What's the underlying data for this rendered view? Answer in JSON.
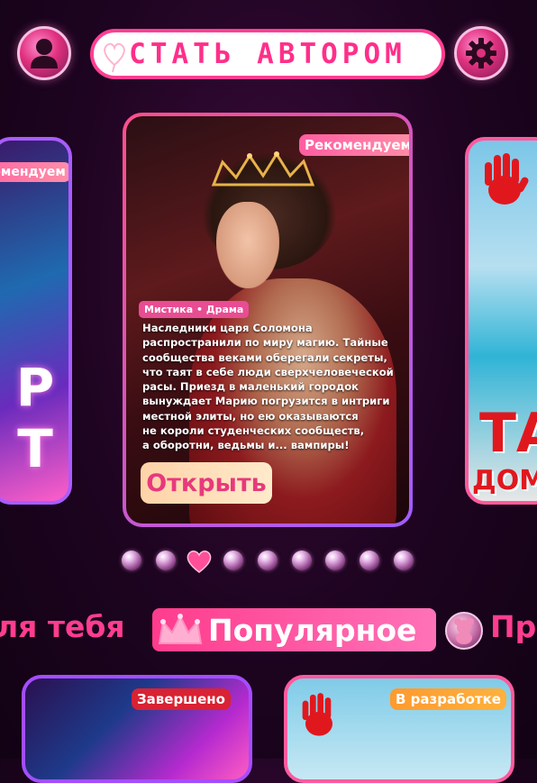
{
  "header": {
    "become_author_label": "СТАТЬ АВТОРОМ",
    "profile_icon": "user-icon",
    "settings_icon": "gear-icon"
  },
  "featured": {
    "left_card": {
      "badge": "Рекомендуем",
      "cover_text": "P T"
    },
    "main_card": {
      "badge": "Рекомендуем",
      "genres": "Мистика • Драма",
      "description_lines": [
        "Наследники царя Соломона",
        "распространили по миру магию. Тайные",
        "сообщества веками оберегали секреты,",
        "что таят в себе люди сверхчеловеческой",
        "расы. Приезд в маленький городок",
        "вынуждает Марию погрузится в интриги",
        "местной элиты, но ею оказываются",
        "не короли студенческих сообществ,",
        "а оборотни, ведьмы и... вампиры!"
      ],
      "open_button": "Открыть"
    },
    "right_card": {
      "cover_text_1": "ТА",
      "cover_text_2": "ДОМ"
    }
  },
  "pagination": {
    "total": 9,
    "active_index": 2
  },
  "categories": {
    "left_partial": "ля тебя",
    "active": "Популярное",
    "right_partial": "Пр"
  },
  "bottom_cards": [
    {
      "badge": "Завершено"
    },
    {
      "badge": "В разработке"
    }
  ],
  "colors": {
    "accent": "#ff3d8f",
    "background": "#1d0420",
    "button_bg": "#ffe3c2"
  }
}
